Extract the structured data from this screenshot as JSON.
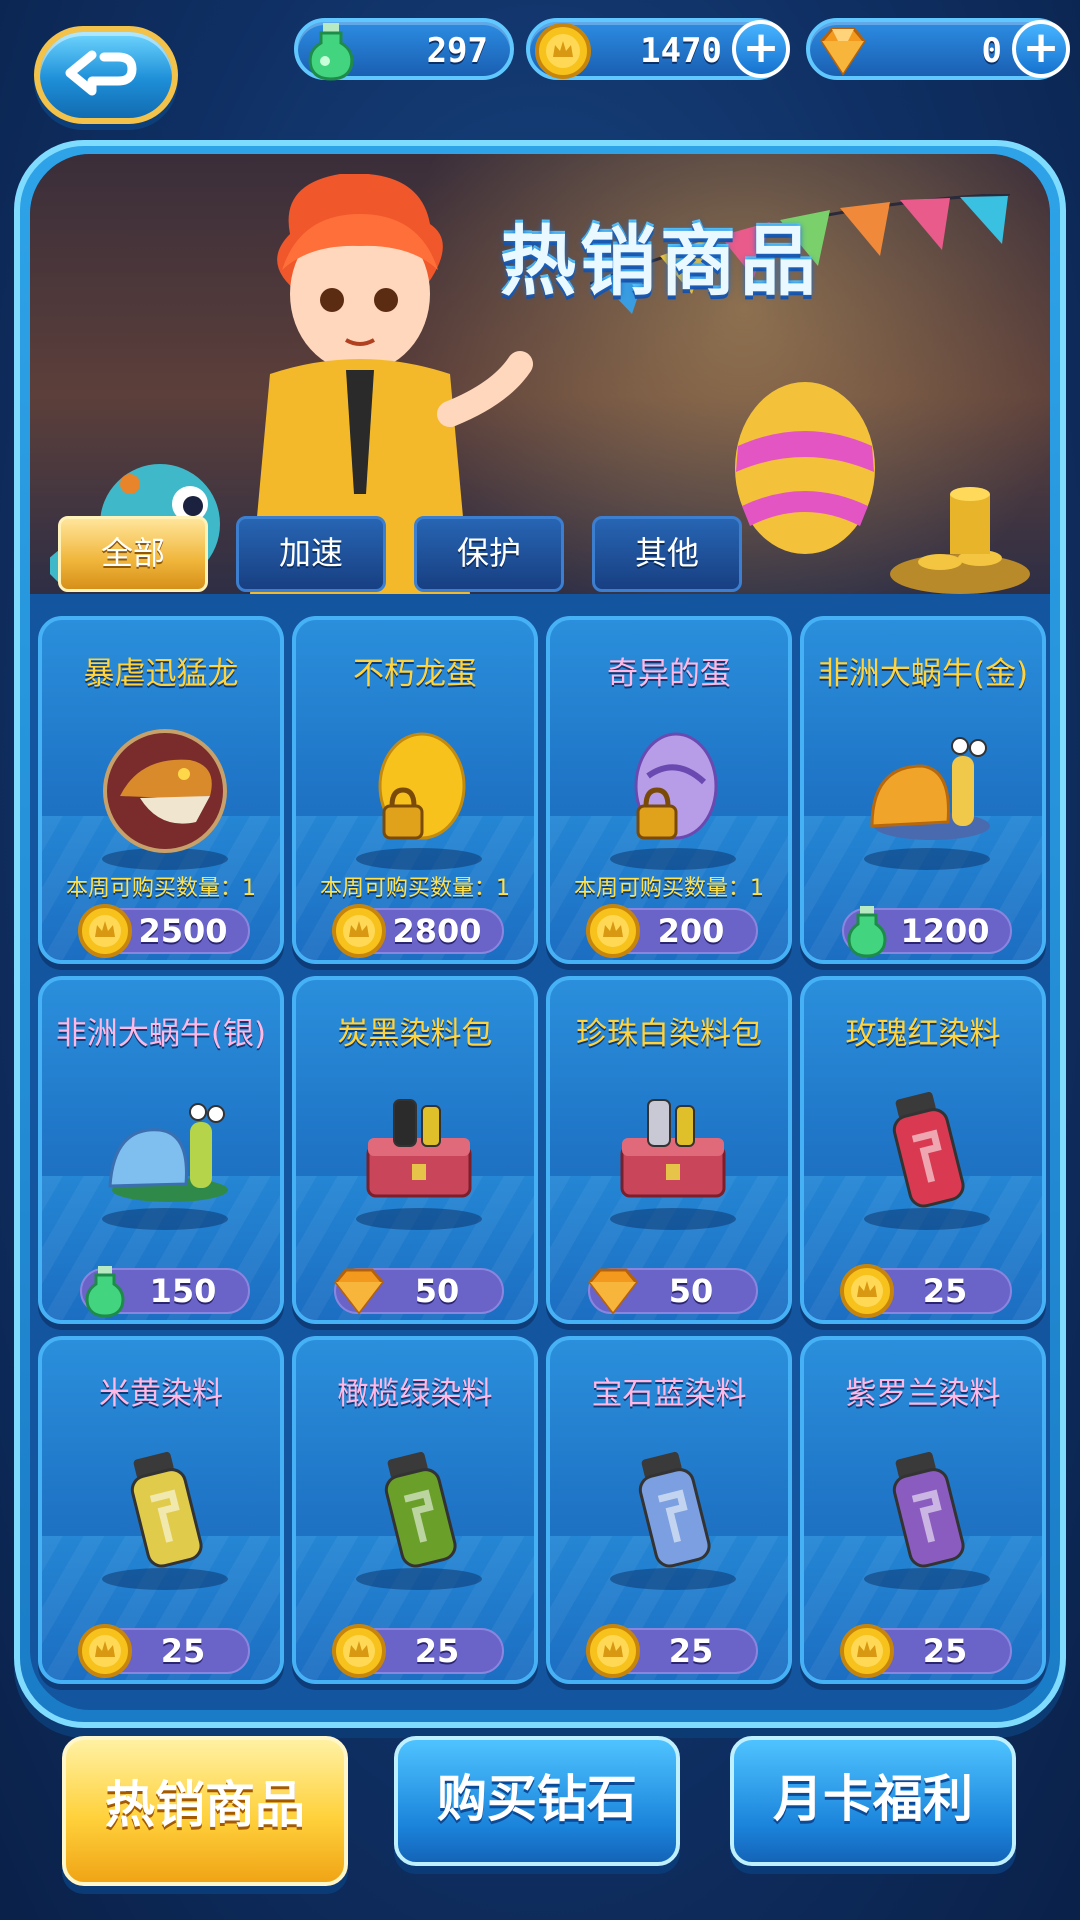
{
  "currencies": [
    {
      "name": "potion",
      "value": "297",
      "has_plus": false
    },
    {
      "name": "coin",
      "value": "1470",
      "has_plus": true
    },
    {
      "name": "diamond",
      "value": "0",
      "has_plus": true
    }
  ],
  "banner": {
    "title": "热销商品"
  },
  "tabs": [
    {
      "label": "全部",
      "active": true
    },
    {
      "label": "加速",
      "active": false
    },
    {
      "label": "保护",
      "active": false
    },
    {
      "label": "其他",
      "active": false
    }
  ],
  "items": [
    {
      "name": "暴虐迅猛龙",
      "limit": "本周可购买数量：1",
      "currency": "coin",
      "price": "2500",
      "icon": "raptor-icon",
      "name_color": "yellow"
    },
    {
      "name": "不朽龙蛋",
      "limit": "本周可购买数量：1",
      "currency": "coin",
      "price": "2800",
      "icon": "golden-egg-icon",
      "name_color": "yellow"
    },
    {
      "name": "奇异的蛋",
      "limit": "本周可购买数量：1",
      "currency": "coin",
      "price": "200",
      "icon": "purple-egg-icon",
      "name_color": "pink"
    },
    {
      "name": "非洲大蜗牛(金)",
      "limit": "",
      "currency": "potion",
      "price": "1200",
      "icon": "gold-snail-icon",
      "name_color": "yellow"
    },
    {
      "name": "非洲大蜗牛(银)",
      "limit": "",
      "currency": "potion",
      "price": "150",
      "icon": "silver-snail-icon",
      "name_color": "pink"
    },
    {
      "name": "炭黑染料包",
      "limit": "",
      "currency": "diamond",
      "price": "50",
      "icon": "dye-chest-black-icon",
      "name_color": "yellow"
    },
    {
      "name": "珍珠白染料包",
      "limit": "",
      "currency": "diamond",
      "price": "50",
      "icon": "dye-chest-white-icon",
      "name_color": "yellow"
    },
    {
      "name": "玫瑰红染料",
      "limit": "",
      "currency": "coin",
      "price": "25",
      "icon": "dye-red-icon",
      "name_color": "yellow"
    },
    {
      "name": "米黄染料",
      "limit": "",
      "currency": "coin",
      "price": "25",
      "icon": "dye-beige-icon",
      "name_color": "pink"
    },
    {
      "name": "橄榄绿染料",
      "limit": "",
      "currency": "coin",
      "price": "25",
      "icon": "dye-olive-icon",
      "name_color": "pink"
    },
    {
      "name": "宝石蓝染料",
      "limit": "",
      "currency": "coin",
      "price": "25",
      "icon": "dye-blue-icon",
      "name_color": "pink"
    },
    {
      "name": "紫罗兰染料",
      "limit": "",
      "currency": "coin",
      "price": "25",
      "icon": "dye-violet-icon",
      "name_color": "pink"
    }
  ],
  "bottom_tabs": [
    {
      "label": "热销商品",
      "active": true
    },
    {
      "label": "购买钻石",
      "active": false
    },
    {
      "label": "月卡福利",
      "active": false
    }
  ],
  "colors": {
    "coin": "#f7c21c",
    "potion": "#3fd27a",
    "diamond": "#f39a1e",
    "accent": "#ffd33d"
  }
}
